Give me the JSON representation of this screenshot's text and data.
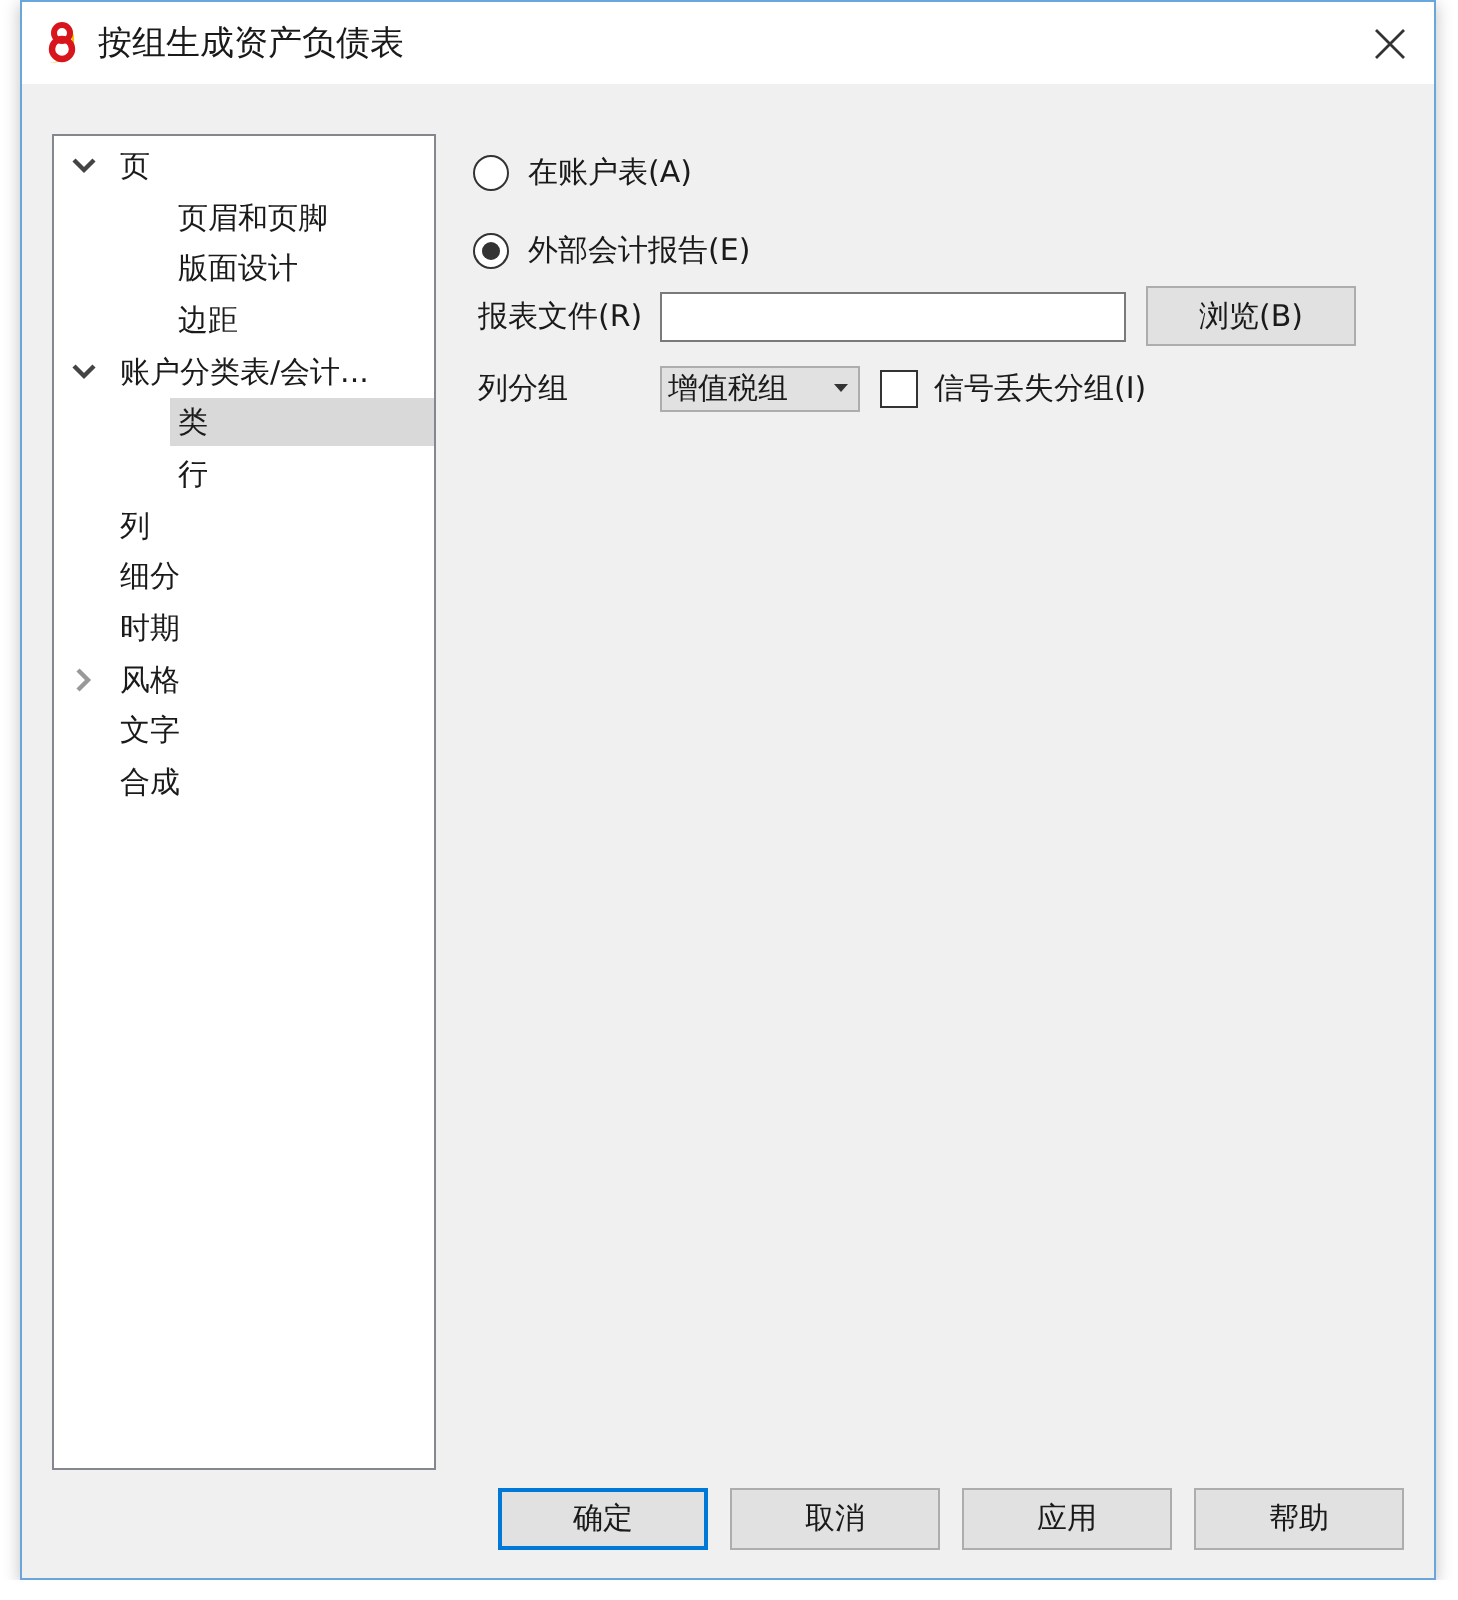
{
  "window": {
    "title": "按组生成资产负债表"
  },
  "tree": [
    {
      "label": "页",
      "kind": "branch",
      "expanded": true,
      "selected": false,
      "children": [
        {
          "label": "页眉和页脚",
          "kind": "leaf",
          "selected": false
        },
        {
          "label": "版面设计",
          "kind": "leaf",
          "selected": false
        },
        {
          "label": "边距",
          "kind": "leaf",
          "selected": false
        }
      ]
    },
    {
      "label": "账户分类表/会计...",
      "kind": "branch",
      "expanded": true,
      "selected": false,
      "children": [
        {
          "label": "类",
          "kind": "leaf",
          "selected": true
        },
        {
          "label": "行",
          "kind": "leaf",
          "selected": false
        }
      ]
    },
    {
      "label": "列",
      "kind": "leaf",
      "selected": false
    },
    {
      "label": "细分",
      "kind": "leaf",
      "selected": false
    },
    {
      "label": "时期",
      "kind": "leaf",
      "selected": false
    },
    {
      "label": "风格",
      "kind": "branch",
      "expanded": false,
      "selected": false
    },
    {
      "label": "文字",
      "kind": "leaf",
      "selected": false
    },
    {
      "label": "合成",
      "kind": "leaf",
      "selected": false
    }
  ],
  "source_options": [
    {
      "label": "在账户表(A)",
      "selected": false
    },
    {
      "label": "外部会计报告(E)",
      "selected": true
    }
  ],
  "report_file": {
    "label": "报表文件(R)",
    "browse_button": "浏览(B)"
  },
  "column_group": {
    "label": "列分组",
    "value": "增值税组"
  },
  "group_checkbox": {
    "label": "信号丢失分组(I)",
    "checked": false
  },
  "buttons": [
    {
      "label": "确定",
      "default": true
    },
    {
      "label": "取消",
      "default": false
    },
    {
      "label": "应用",
      "default": false
    },
    {
      "label": "帮助",
      "default": false
    }
  ]
}
